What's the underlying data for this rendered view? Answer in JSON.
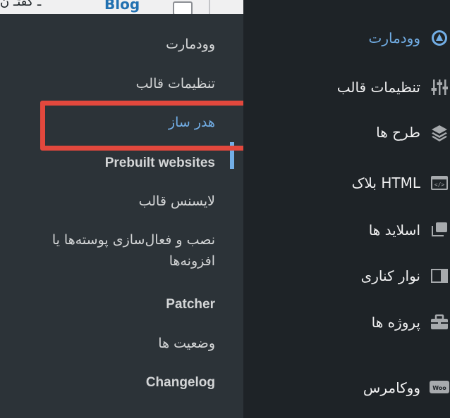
{
  "topbar": {
    "blog_label": "Blog",
    "rtl_text": "ـ گفتـ ن"
  },
  "submenu": {
    "items": [
      {
        "label": "وودمارت"
      },
      {
        "label": "تنظیمات قالب"
      },
      {
        "label": "هدر ساز",
        "current": true
      },
      {
        "label": "Prebuilt websites"
      },
      {
        "label": "لایسنس قالب"
      },
      {
        "label": "نصب و فعال‌سازی پوسته‌ها یا افزونه‌ها"
      },
      {
        "label": "Patcher"
      },
      {
        "label": "وضعیت ها"
      },
      {
        "label": "Changelog"
      }
    ]
  },
  "main_menu": {
    "items": [
      {
        "label": "وودمارت",
        "icon": "woodmart-logo-icon",
        "current": true
      },
      {
        "label": "تنظیمات قالب",
        "icon": "sliders-icon"
      },
      {
        "label": "طرح ها",
        "icon": "layers-icon"
      },
      {
        "label": "بلاک HTML",
        "icon": "code-block-icon"
      },
      {
        "label": "اسلاید ها",
        "icon": "slides-icon"
      },
      {
        "label": "نوار کناری",
        "icon": "sidebar-icon"
      },
      {
        "label": "پروژه ها",
        "icon": "briefcase-icon"
      },
      {
        "label": "ووکامرس",
        "icon": "woocommerce-icon"
      }
    ]
  },
  "colors": {
    "menu_bg": "#1e2327",
    "submenu_bg": "#2c3338",
    "accent": "#72aee6",
    "highlight": "#e2483d"
  }
}
